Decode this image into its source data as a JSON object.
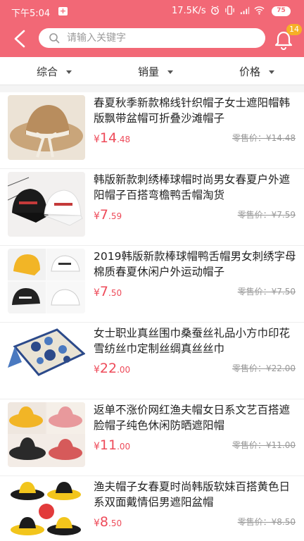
{
  "status_bar": {
    "time": "下午5:04",
    "network_speed": "17.5K/s",
    "battery": "75"
  },
  "header": {
    "search_placeholder": "请输入关键字",
    "notification_count": "14",
    "accent_color": "#f26876"
  },
  "sort_tabs": [
    {
      "label": "综合"
    },
    {
      "label": "销量"
    },
    {
      "label": "价格"
    }
  ],
  "products": [
    {
      "title": "春夏秋季新款棉线针织帽子女士遮阳帽韩版飘带盆帽可折叠沙滩帽子",
      "yen": "¥",
      "price_int": "14",
      "price_dec": ".48",
      "retail": "零售价：¥14.48"
    },
    {
      "title": "韩版新款刺绣棒球帽时尚男女春夏户外遮阳帽子百搭弯檐鸭舌帽淘货",
      "yen": "¥",
      "price_int": "7",
      "price_dec": ".59",
      "retail": "零售价：¥7.59"
    },
    {
      "title": "2019韩版新款棒球帽鸭舌帽男女刺绣字母棉质春夏休闲户外运动帽子",
      "yen": "¥",
      "price_int": "7",
      "price_dec": ".50",
      "retail": "零售价：¥7.50"
    },
    {
      "title": "女士职业真丝围巾桑蚕丝礼品小方巾印花雪纺丝巾定制丝绸真丝丝巾",
      "yen": "¥",
      "price_int": "22",
      "price_dec": ".00",
      "retail": "零售价：¥22.00"
    },
    {
      "title": "返单不涨价网红渔夫帽女日系文艺百搭遮脸帽子纯色休闲防晒遮阳帽",
      "yen": "¥",
      "price_int": "11",
      "price_dec": ".00",
      "retail": "零售价：¥11.00"
    },
    {
      "title": "渔夫帽子女春夏时尚韩版软妹百搭黄色日系双面戴情侣男遮阳盆帽",
      "yen": "¥",
      "price_int": "8",
      "price_dec": ".50",
      "retail": "零售价：¥8.50"
    }
  ]
}
